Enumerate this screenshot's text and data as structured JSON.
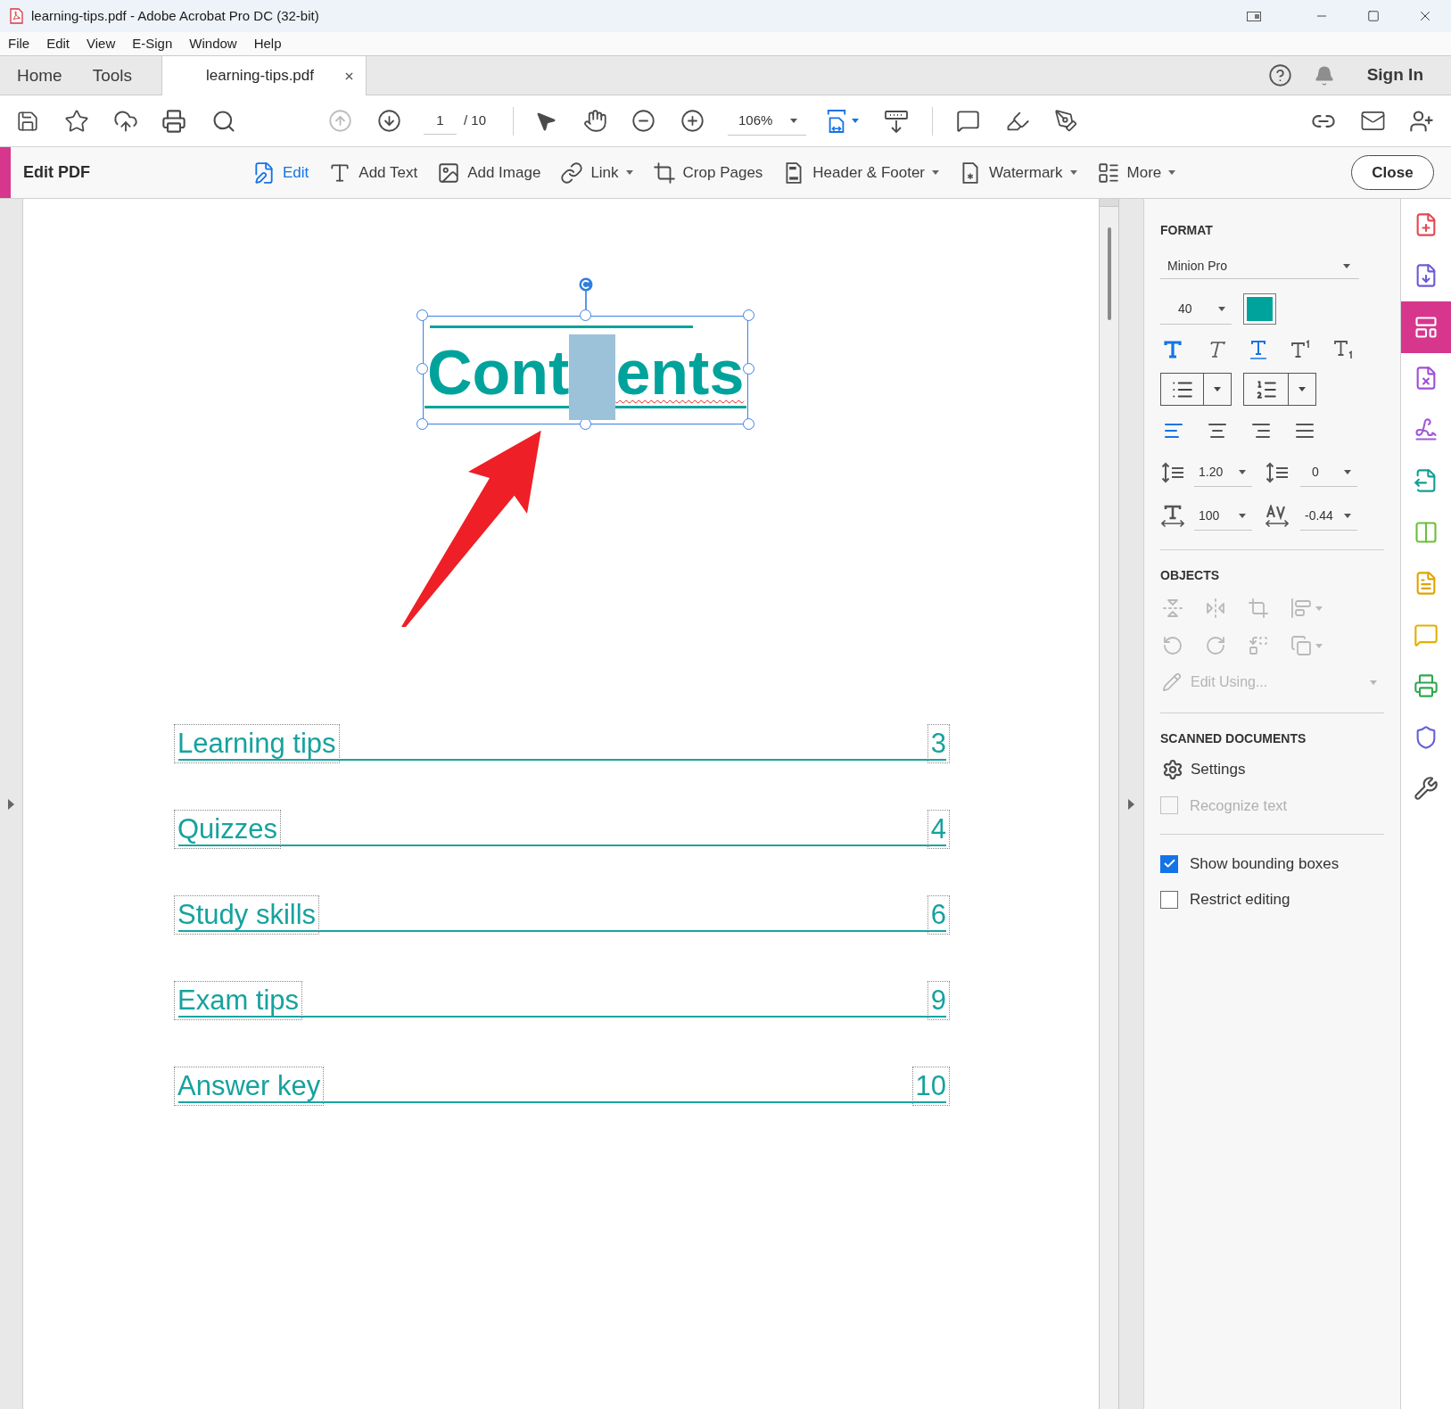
{
  "window": {
    "title": "learning-tips.pdf - Adobe Acrobat Pro DC (32-bit)"
  },
  "menu": [
    "File",
    "Edit",
    "View",
    "E-Sign",
    "Window",
    "Help"
  ],
  "tabs": [
    {
      "label": "Home",
      "selected": false,
      "closable": false
    },
    {
      "label": "Tools",
      "selected": false,
      "closable": false
    },
    {
      "label": "learning-tips.pdf",
      "selected": true,
      "closable": true
    }
  ],
  "account": {
    "label": "Sign In"
  },
  "toolbar": {
    "previous_page": {
      "disabled": true
    },
    "next_page": {
      "disabled": false
    },
    "page": {
      "value": "1"
    },
    "page_count": "/ 10",
    "zoom": {
      "value": "106%"
    }
  },
  "edit_bar": {
    "title": "Edit PDF",
    "tools": [
      {
        "label": "Edit",
        "selected": true,
        "dropdown": false
      },
      {
        "label": "Add Text",
        "selected": false,
        "dropdown": false
      },
      {
        "label": "Add Image",
        "selected": false,
        "dropdown": false
      },
      {
        "label": "Link",
        "selected": false,
        "dropdown": true
      },
      {
        "label": "Crop Pages",
        "selected": false,
        "dropdown": false
      },
      {
        "label": "Header & Footer",
        "selected": false,
        "dropdown": true
      },
      {
        "label": "Watermark",
        "selected": false,
        "dropdown": true
      },
      {
        "label": "More",
        "selected": false,
        "dropdown": true
      }
    ],
    "close": {
      "label": "Close"
    }
  },
  "document": {
    "title_box": {
      "selected": true,
      "parts": [
        {
          "kind": "text",
          "text": "Cont",
          "misspelled": false
        },
        {
          "kind": "selection"
        },
        {
          "kind": "text",
          "text": "ents",
          "misspelled": true
        }
      ]
    },
    "toc": [
      {
        "title": "Learning tips",
        "page": "3"
      },
      {
        "title": "Quizzes",
        "page": "4"
      },
      {
        "title": "Study skills",
        "page": "6"
      },
      {
        "title": "Exam tips",
        "page": "9"
      },
      {
        "title": "Answer key",
        "page": "10"
      }
    ]
  },
  "format_panel": {
    "heading": "FORMAT",
    "font": {
      "value": "Minion Pro"
    },
    "size": {
      "value": "40"
    },
    "text_color": {
      "color": "#00a39c"
    },
    "styles": [
      {
        "selected": true
      },
      {
        "selected": false
      },
      {
        "selected": true
      },
      {
        "selected": false
      },
      {
        "selected": false
      }
    ],
    "alignment": [
      {
        "selected": true
      },
      {
        "selected": false
      },
      {
        "selected": false
      },
      {
        "selected": false
      }
    ],
    "line_spacing": {
      "value": "1.20"
    },
    "paragraph_spacing": {
      "value": "0"
    },
    "horizontal_scale": {
      "value": "100"
    },
    "character_spacing": {
      "value": "-0.44"
    }
  },
  "objects_panel": {
    "heading": "OBJECTS",
    "disabled": true,
    "edit_using": {
      "label": "Edit Using...",
      "disabled": true
    }
  },
  "scanned_panel": {
    "heading": "SCANNED DOCUMENTS",
    "settings": {
      "label": "Settings"
    },
    "recognize_text": {
      "label": "Recognize text",
      "checked": false,
      "disabled": true
    }
  },
  "options": [
    {
      "label": "Show bounding boxes",
      "checked": true
    },
    {
      "label": "Restrict editing",
      "checked": false
    }
  ],
  "tools_sidebar": [
    {
      "selected": false
    },
    {
      "selected": false
    },
    {
      "selected": true
    },
    {
      "selected": false
    },
    {
      "selected": false
    },
    {
      "selected": false
    },
    {
      "selected": false
    },
    {
      "selected": false
    },
    {
      "selected": false
    },
    {
      "selected": false
    },
    {
      "selected": false
    },
    {
      "selected": false
    }
  ]
}
